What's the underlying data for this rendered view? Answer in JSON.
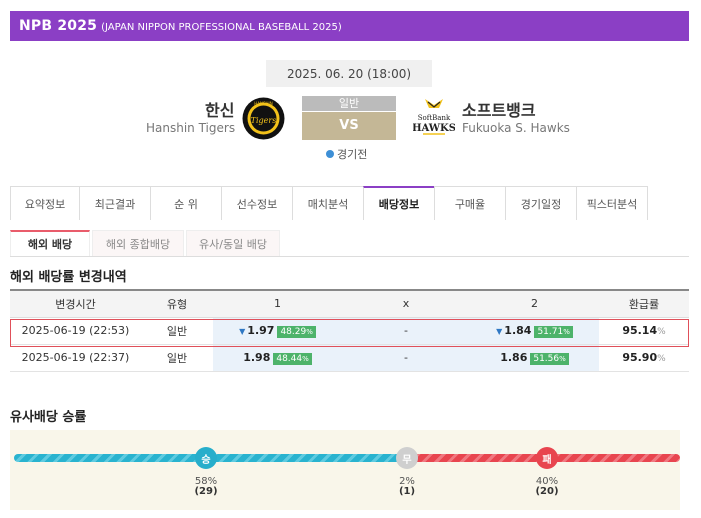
{
  "header": {
    "title": "NPB 2025",
    "subtitle": "(JAPAN NIPPON PROFESSIONAL BASEBALL 2025)"
  },
  "match": {
    "datetime": "2025. 06. 20 (18:00)",
    "home": {
      "name_ko": "한신",
      "name_en": "Hanshin Tigers"
    },
    "away": {
      "name_ko": "소프트뱅크",
      "name_en": "Fukuoka S. Hawks"
    },
    "type": "일반",
    "vs": "VS",
    "status": "경기전"
  },
  "tabs": [
    "요약정보",
    "최근결과",
    "순 위",
    "선수정보",
    "매치분석",
    "배당정보",
    "구매율",
    "경기일정",
    "픽스터분석"
  ],
  "active_tab": "배당정보",
  "subtabs": [
    "해외 배당",
    "해외 종합배당",
    "유사/동일 배당"
  ],
  "odds_section": {
    "title": "해외 배당률 변경내역",
    "headers": [
      "변경시간",
      "유형",
      "1",
      "x",
      "2",
      "환급률"
    ],
    "rows": [
      {
        "time": "2025-06-19 (22:53)",
        "type": "일반",
        "o1": "1.97",
        "p1": "48.29",
        "ox": "-",
        "o2": "1.84",
        "p2": "51.71",
        "refund": "95.14",
        "arrow1": "down",
        "arrow2": "down"
      },
      {
        "time": "2025-06-19 (22:37)",
        "type": "일반",
        "o1": "1.98",
        "p1": "48.44",
        "ox": "-",
        "o2": "1.86",
        "p2": "51.56",
        "refund": "95.90"
      }
    ],
    "pct_unit": "%"
  },
  "similar_section": {
    "title": "유사배당 승률",
    "win": {
      "label": "승",
      "pct": "58%",
      "count": "(29)"
    },
    "draw": {
      "label": "무",
      "pct": "2%",
      "count": "(1)"
    },
    "loss": {
      "label": "패",
      "pct": "40%",
      "count": "(20)"
    }
  },
  "logos": {
    "home_logo_text": "Tigers",
    "away_logo_text": "SoftBank HAWKS"
  },
  "colors": {
    "accent": "#8b3fc5",
    "win": "#2fb5cf",
    "draw": "#c8c8c8",
    "loss": "#e8454f",
    "pct_badge": "#4db36a"
  }
}
